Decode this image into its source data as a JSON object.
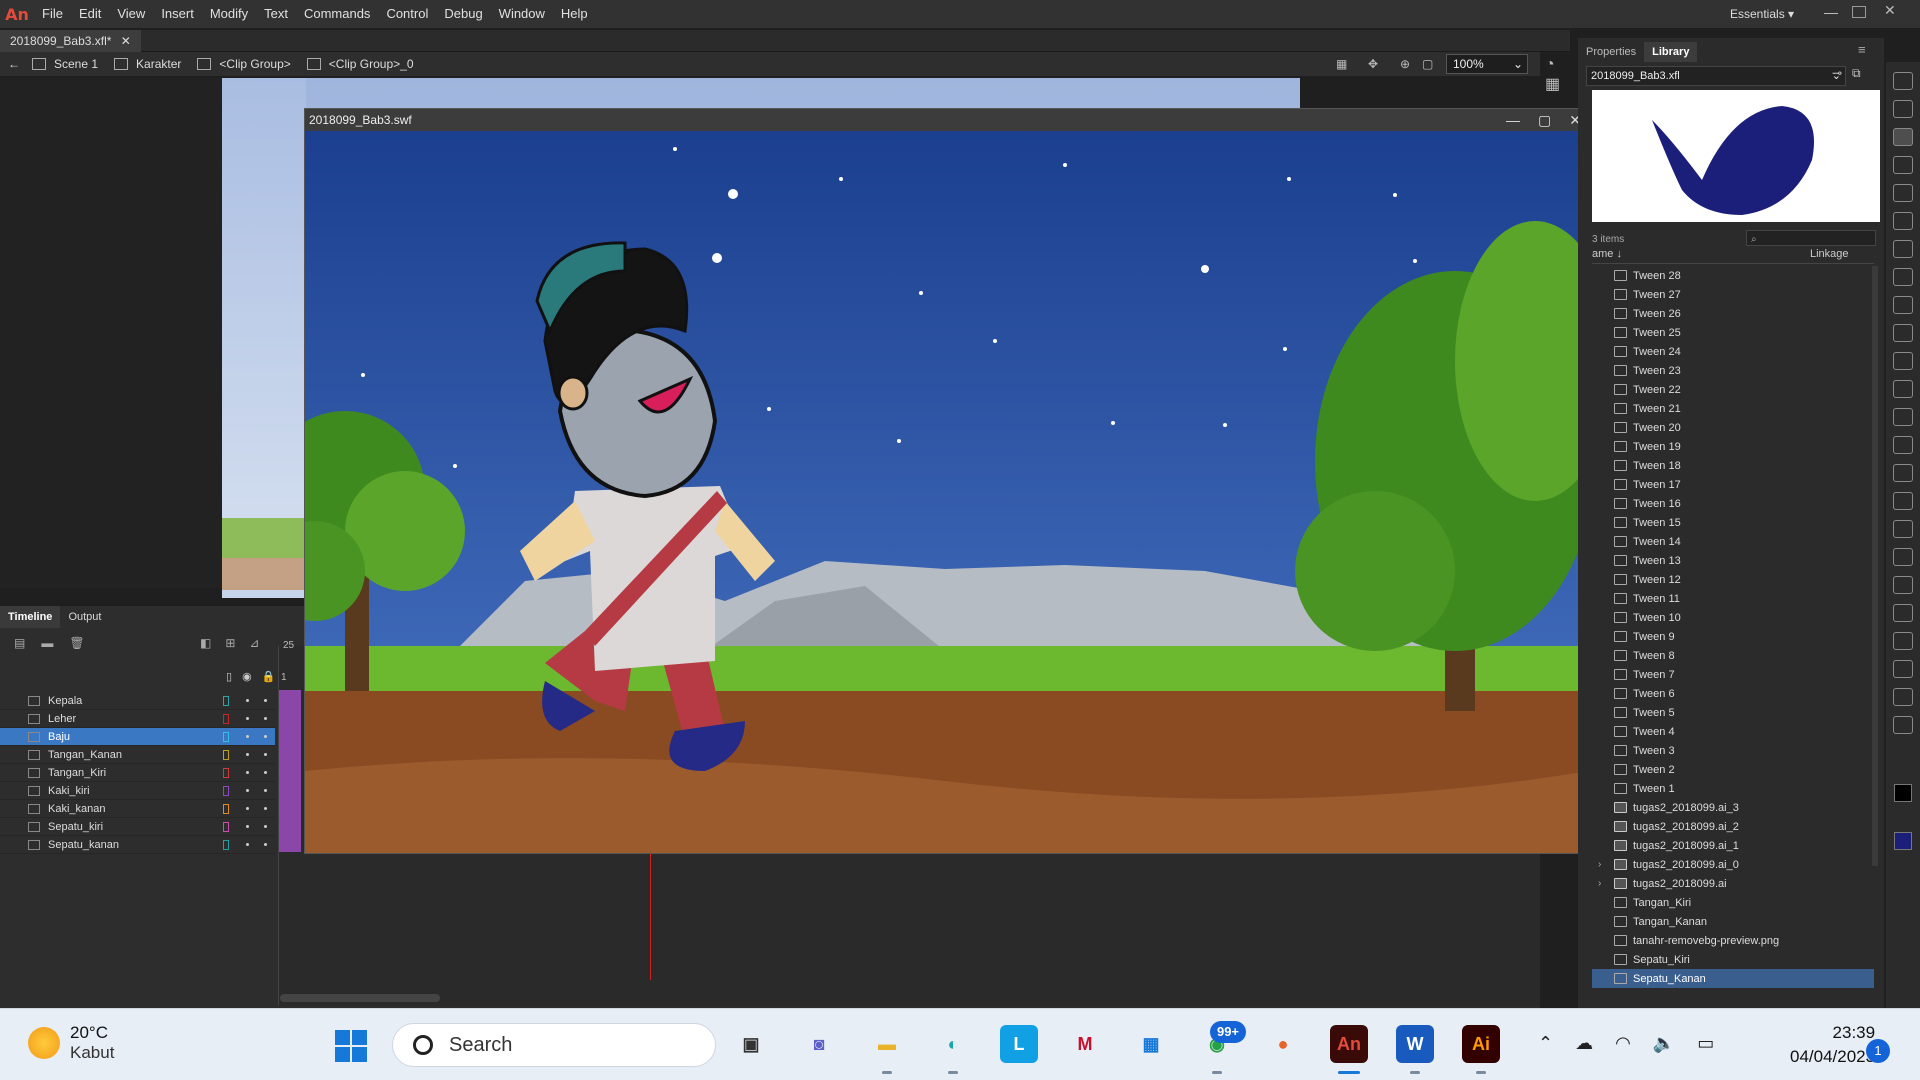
{
  "app": {
    "logo": "An"
  },
  "menu": [
    "File",
    "Edit",
    "View",
    "Insert",
    "Modify",
    "Text",
    "Commands",
    "Control",
    "Debug",
    "Window",
    "Help"
  ],
  "workspace": "Essentials",
  "document_tab": "2018099_Bab3.xfl*",
  "breadcrumb": [
    "Scene 1",
    "Karakter",
    "<Clip Group>",
    "<Clip Group>_0"
  ],
  "zoom": "100%",
  "swf_window": {
    "title": "2018099_Bab3.swf"
  },
  "timeline": {
    "tabs": [
      "Timeline",
      "Output"
    ],
    "frame_label_25": "25",
    "frame_label_1": "1",
    "layers": [
      {
        "name": "Kepala",
        "color": "#2ea4a4"
      },
      {
        "name": "Leher",
        "color": "#c22a2a"
      },
      {
        "name": "Baju",
        "color": "#34c0e8",
        "selected": true
      },
      {
        "name": "Tangan_Kanan",
        "color": "#c0a020"
      },
      {
        "name": "Tangan_Kiri",
        "color": "#d03a3a"
      },
      {
        "name": "Kaki_kiri",
        "color": "#8e4ac0"
      },
      {
        "name": "Kaki_kanan",
        "color": "#e08a20"
      },
      {
        "name": "Sepatu_kiri",
        "color": "#d04ab0"
      },
      {
        "name": "Sepatu_kanan",
        "color": "#20a0a0"
      }
    ]
  },
  "panel": {
    "tabs": [
      "Properties",
      "Library"
    ],
    "library_file": "2018099_Bab3.xfl",
    "items_count": "3 items",
    "col_name": "ame",
    "col_linkage": "Linkage",
    "items": [
      {
        "label": "Tween 28",
        "icon": "graphic-icon"
      },
      {
        "label": "Tween 27",
        "icon": "graphic-icon"
      },
      {
        "label": "Tween 26",
        "icon": "graphic-icon"
      },
      {
        "label": "Tween 25",
        "icon": "graphic-icon"
      },
      {
        "label": "Tween 24",
        "icon": "graphic-icon"
      },
      {
        "label": "Tween 23",
        "icon": "graphic-icon"
      },
      {
        "label": "Tween 22",
        "icon": "graphic-icon"
      },
      {
        "label": "Tween 21",
        "icon": "graphic-icon"
      },
      {
        "label": "Tween 20",
        "icon": "graphic-icon"
      },
      {
        "label": "Tween 19",
        "icon": "graphic-icon"
      },
      {
        "label": "Tween 18",
        "icon": "graphic-icon"
      },
      {
        "label": "Tween 17",
        "icon": "graphic-icon"
      },
      {
        "label": "Tween 16",
        "icon": "graphic-icon"
      },
      {
        "label": "Tween 15",
        "icon": "graphic-icon"
      },
      {
        "label": "Tween 14",
        "icon": "graphic-icon"
      },
      {
        "label": "Tween 13",
        "icon": "graphic-icon"
      },
      {
        "label": "Tween 12",
        "icon": "graphic-icon"
      },
      {
        "label": "Tween 11",
        "icon": "graphic-icon"
      },
      {
        "label": "Tween 10",
        "icon": "graphic-icon"
      },
      {
        "label": "Tween 9",
        "icon": "graphic-icon"
      },
      {
        "label": "Tween 8",
        "icon": "graphic-icon"
      },
      {
        "label": "Tween 7",
        "icon": "graphic-icon"
      },
      {
        "label": "Tween 6",
        "icon": "graphic-icon"
      },
      {
        "label": "Tween 5",
        "icon": "graphic-icon"
      },
      {
        "label": "Tween 4",
        "icon": "graphic-icon"
      },
      {
        "label": "Tween 3",
        "icon": "graphic-icon"
      },
      {
        "label": "Tween 2",
        "icon": "graphic-icon"
      },
      {
        "label": "Tween 1",
        "icon": "graphic-icon"
      },
      {
        "label": "tugas2_2018099.ai_3",
        "icon": "folder-icon"
      },
      {
        "label": "tugas2_2018099.ai_2",
        "icon": "folder-icon"
      },
      {
        "label": "tugas2_2018099.ai_1",
        "icon": "folder-icon"
      },
      {
        "label": "tugas2_2018099.ai_0",
        "icon": "folder-icon",
        "expandable": true
      },
      {
        "label": "tugas2_2018099.ai",
        "icon": "folder-icon",
        "expandable": true
      },
      {
        "label": "Tangan_Kiri",
        "icon": "graphic-icon"
      },
      {
        "label": "Tangan_Kanan",
        "icon": "graphic-icon"
      },
      {
        "label": "tanahr-removebg-preview.png",
        "icon": "bitmap-icon"
      },
      {
        "label": "Sepatu_Kiri",
        "icon": "graphic-icon"
      },
      {
        "label": "Sepatu_Kanan",
        "icon": "graphic-icon",
        "selected": true
      }
    ]
  },
  "colors": {
    "fill_stroke": "#000000",
    "fill": "#1c1f7a",
    "accent": "#3b78c4"
  },
  "taskbar": {
    "weather_temp": "20°C",
    "weather_cond": "Kabut",
    "search_placeholder": "Search",
    "whatsapp_badge": "99+",
    "clock_time": "23:39",
    "clock_date": "04/04/2023",
    "notifications": "1",
    "apps": [
      "windows-start",
      "file-explorer",
      "teams",
      "folder",
      "edge",
      "l-app",
      "mcafee",
      "store",
      "whatsapp",
      "firefox",
      "animate",
      "word",
      "illustrator"
    ]
  }
}
